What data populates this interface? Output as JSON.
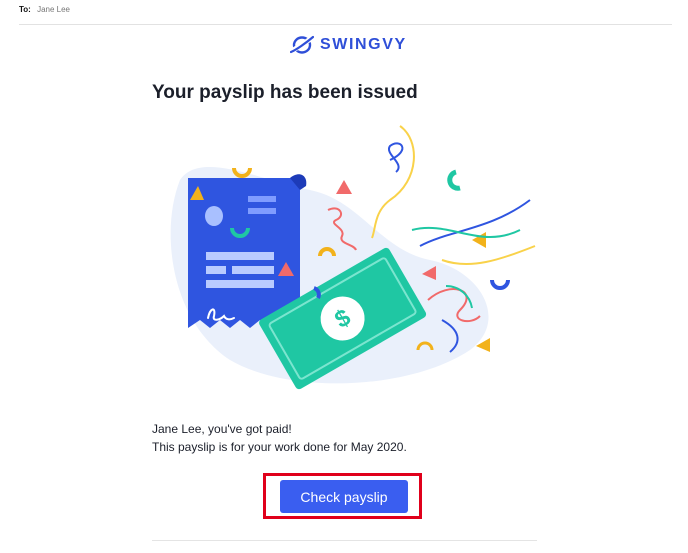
{
  "header": {
    "to_label": "To:",
    "recipient": "Jane Lee"
  },
  "brand": {
    "name": "SWINGVY",
    "color": "#2f4fd8"
  },
  "email": {
    "headline": "Your payslip has been issued",
    "line1": "Jane Lee, you've got paid!",
    "line2": "This payslip is for your work done for May 2020.",
    "cta_label": "Check payslip"
  },
  "colors": {
    "accent": "#3a5ef0",
    "highlight": "#e0001b",
    "money": "#1fc7a3"
  },
  "icons": [
    "swingvy-logo-icon",
    "payslip-illustration",
    "dollar-icon",
    "signature-icon"
  ]
}
